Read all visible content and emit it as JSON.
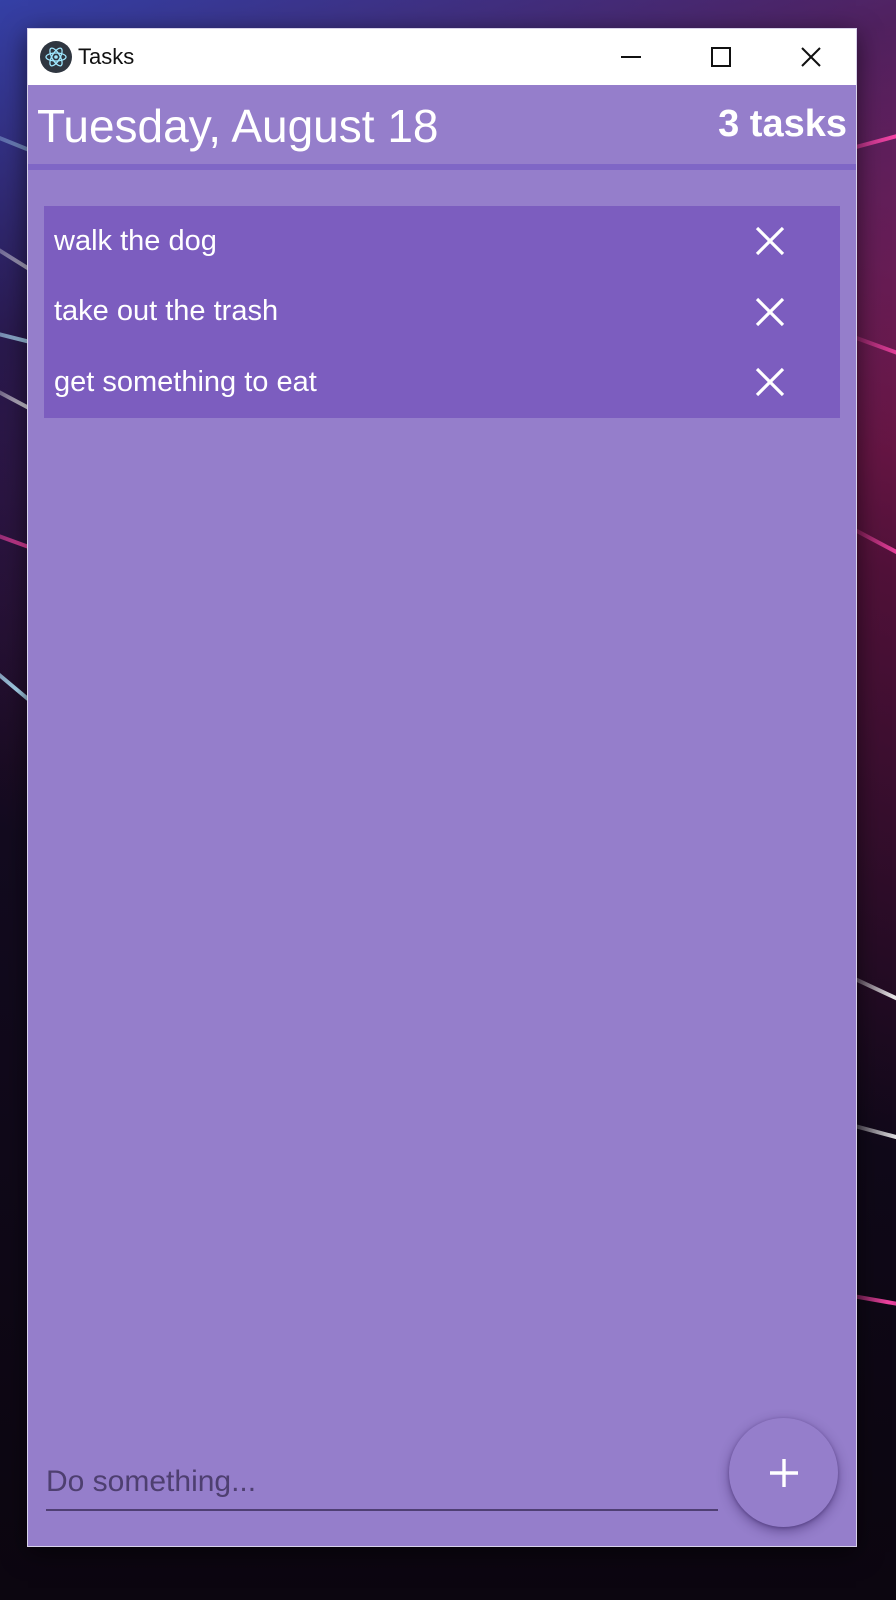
{
  "window": {
    "title": "Tasks",
    "icon": "electron-atom-icon",
    "controls": [
      "minimize-icon",
      "maximize-icon",
      "close-icon"
    ]
  },
  "header": {
    "date": "Tuesday, August 18",
    "count": "3 tasks"
  },
  "tasks": [
    {
      "text": "walk the dog"
    },
    {
      "text": "take out the trash"
    },
    {
      "text": "get something to eat"
    }
  ],
  "input": {
    "placeholder": "Do something...",
    "value": ""
  },
  "add_button": {
    "icon": "plus-icon"
  },
  "colors": {
    "background": "#957ecb",
    "list_background": "#7c5dbf",
    "header_rule": "#7f66c6",
    "text": "#ffffff"
  }
}
